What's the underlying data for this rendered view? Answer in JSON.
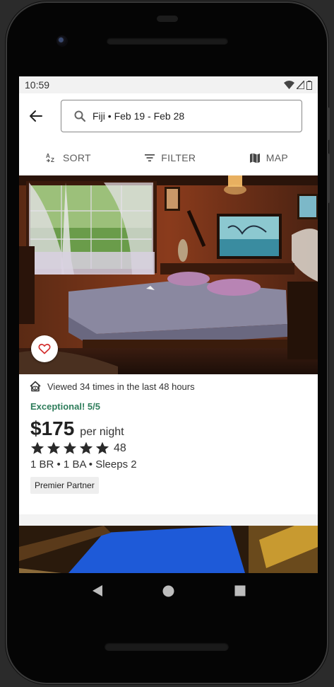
{
  "status_bar": {
    "time": "10:59"
  },
  "search": {
    "query": "Fiji • Feb 19 - Feb 28"
  },
  "toolbar": {
    "sort_label": "SORT",
    "filter_label": "FILTER",
    "map_label": "MAP"
  },
  "listing": {
    "viewed_text": "Viewed 34 times in the last 48 hours",
    "rating_text": "Exceptional! 5/5",
    "price": "$175",
    "price_unit": "per night",
    "stars": 5,
    "review_count": "48",
    "specs": "1 BR • 1 BA • Sleeps 2",
    "badge": "Premier Partner",
    "favorited": false
  },
  "colors": {
    "accent_green": "#2e7d5b",
    "heart_red": "#d32f2f",
    "text_dark": "#222222",
    "toolbar_gray": "#5c5c5c"
  },
  "icons": {
    "back": "arrow-left-icon",
    "search": "search-icon",
    "sort": "sort-az-icon",
    "filter": "filter-icon",
    "map": "map-icon",
    "favorite": "heart-outline-icon",
    "viewed": "house-eye-icon",
    "star": "star-icon",
    "nav_back": "triangle-back-icon",
    "nav_home": "circle-home-icon",
    "nav_recents": "square-recents-icon"
  }
}
